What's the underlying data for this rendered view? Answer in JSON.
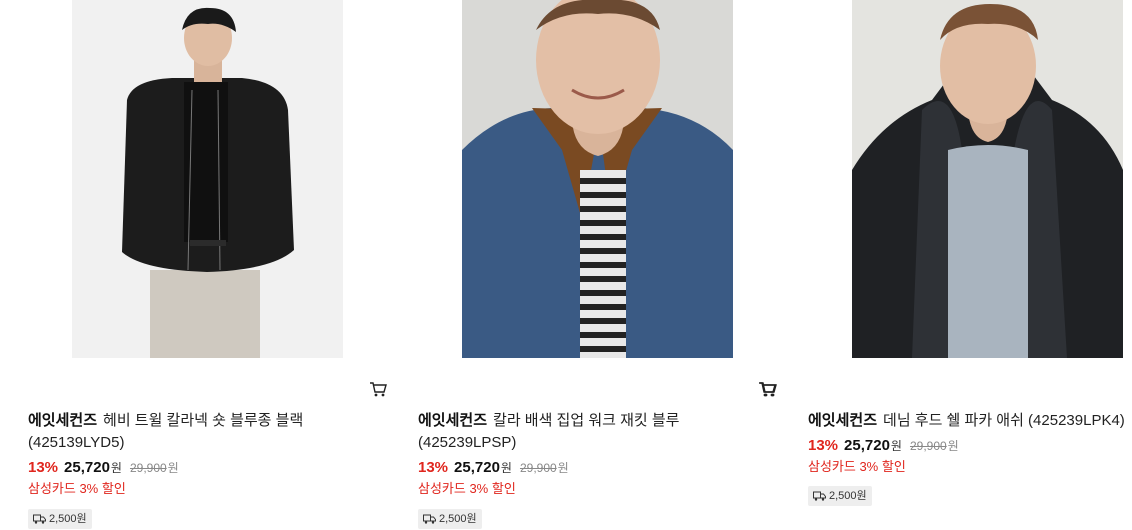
{
  "products": [
    {
      "brand": "에잇세컨즈",
      "name": "헤비 트윌 칼라넥 숏 블루종 블랙 (425139LYD5)",
      "discount_rate": "13%",
      "price": "25,720",
      "currency": "원",
      "original_price": "29,900",
      "card_promo": "삼성카드 3% 할인",
      "shipping_fee": "2,500원",
      "icons": [
        "cart-icon",
        "truck-icon"
      ]
    },
    {
      "brand": "에잇세컨즈",
      "name": "칼라 배색 집업 워크 재킷 블루 (425239LPSP)",
      "discount_rate": "13%",
      "price": "25,720",
      "currency": "원",
      "original_price": "29,900",
      "card_promo": "삼성카드 3% 할인",
      "shipping_fee": "2,500원",
      "icons": [
        "cart-icon",
        "truck-icon"
      ]
    },
    {
      "brand": "에잇세컨즈",
      "name": "데님 후드 쉘 파카 애쉬 (425239LPK4)",
      "discount_rate": "13%",
      "price": "25,720",
      "currency": "원",
      "original_price": "29,900",
      "card_promo": "삼성카드 3% 할인",
      "shipping_fee": "2,500원",
      "icons": [
        "cart-icon",
        "truck-icon"
      ]
    }
  ],
  "colors": {
    "discount": "#e0261e",
    "text": "#111111",
    "muted": "#888888",
    "badge_bg": "#eeeeee"
  }
}
